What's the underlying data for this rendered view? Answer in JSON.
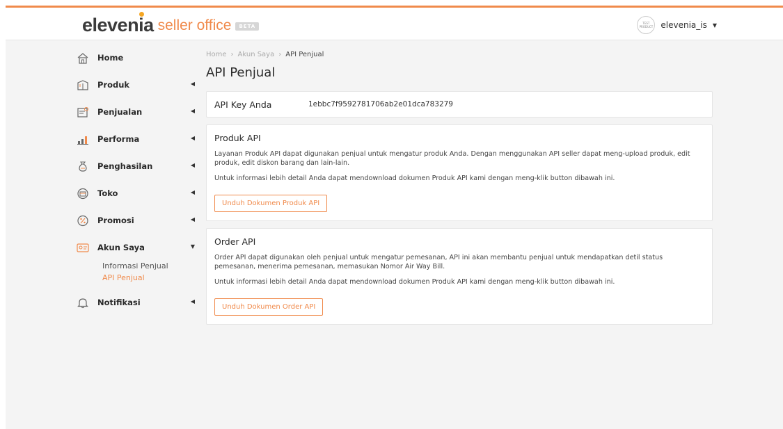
{
  "header": {
    "logo_brand_pre": "elevenia",
    "logo_sub": "seller office",
    "beta": "BETA",
    "avatar_text": "TEST PRODUCT",
    "username": "elevenia_is"
  },
  "sidebar": {
    "items": [
      {
        "label": "Home",
        "icon": "home-icon"
      },
      {
        "label": "Produk",
        "icon": "product-icon"
      },
      {
        "label": "Penjualan",
        "icon": "sales-icon"
      },
      {
        "label": "Performa",
        "icon": "performance-icon"
      },
      {
        "label": "Penghasilan",
        "icon": "income-icon"
      },
      {
        "label": "Toko",
        "icon": "store-icon"
      },
      {
        "label": "Promosi",
        "icon": "promo-icon"
      },
      {
        "label": "Akun Saya",
        "icon": "account-icon"
      },
      {
        "label": "Notifikasi",
        "icon": "bell-icon"
      }
    ],
    "sub_items": [
      {
        "label": "Informasi Penjual",
        "active": false
      },
      {
        "label": "API Penjual",
        "active": true
      }
    ]
  },
  "breadcrumb": [
    "Home",
    "Akun Saya",
    "API Penjual"
  ],
  "page_title": "API Penjual",
  "api_key": {
    "label": "API Key Anda",
    "value": "1ebbc7f9592781706ab2e01dca783279"
  },
  "produk_api": {
    "title": "Produk API",
    "desc": "Layanan Produk API dapat digunakan penjual untuk mengatur produk Anda. Dengan menggunakan API seller dapat meng-upload produk, edit produk, edit diskon barang dan lain-lain.",
    "info": "Untuk informasi lebih detail Anda dapat mendownload dokumen Produk API kami dengan meng-klik button dibawah ini.",
    "button": "Unduh Dokumen Produk API"
  },
  "order_api": {
    "title": "Order API",
    "desc": "Order API dapat digunakan oleh penjual untuk mengatur pemesanan, API ini akan membantu penjual untuk mendapatkan detil status pemesanan, menerima pemesanan, memasukan Nomor Air Way Bill.",
    "info": "Untuk informasi lebih detail Anda dapat mendownload dokumen Produk API kami dengan meng-klik button dibawah ini.",
    "button": "Unduh Dokumen Order API"
  },
  "colors": {
    "accent": "#f08a4b",
    "logo_dot": "#f5a623",
    "background": "#f4f4f4"
  }
}
